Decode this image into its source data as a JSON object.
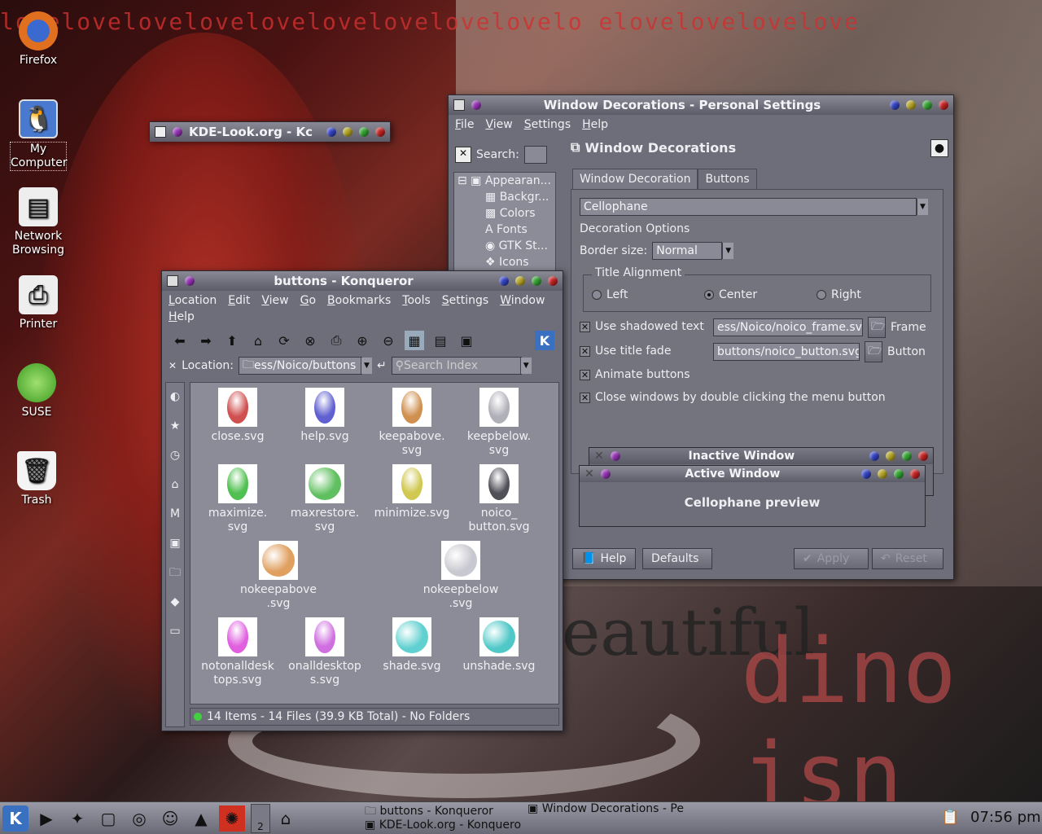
{
  "desktop": {
    "wallpaper_text": "lovelovelovelovelovelovelovelovelovelo elovelovelovelove",
    "wallpaper_big1": "eautiful",
    "wallpaper_big2": "dino jsn",
    "icons": [
      {
        "label": "Firefox"
      },
      {
        "label": "My Computer"
      },
      {
        "label": "Network Browsing"
      },
      {
        "label": "Printer"
      },
      {
        "label": "SUSE"
      },
      {
        "label": "Trash"
      }
    ]
  },
  "kdelook_window": {
    "title": "KDE-Look.org - Kc"
  },
  "konqueror": {
    "title": "buttons - Konqueror",
    "menu": [
      "Location",
      "Edit",
      "View",
      "Go",
      "Bookmarks",
      "Tools",
      "Settings",
      "Window",
      "Help"
    ],
    "location_label": "Location:",
    "location_value": "ess/Noico/buttons",
    "search_placeholder": "Search Index",
    "files": [
      {
        "name": "close.svg",
        "color": "#d05050"
      },
      {
        "name": "help.svg",
        "color": "#6060d0"
      },
      {
        "name": "keepabove.\nsvg",
        "color": "#d09050"
      },
      {
        "name": "keepbelow.\nsvg",
        "color": "#b0b0b8"
      },
      {
        "name": "maximize.\nsvg",
        "color": "#50c050"
      },
      {
        "name": "maxrestore.\nsvg",
        "color": "#60c060"
      },
      {
        "name": "minimize.svg",
        "color": "#d0c850"
      },
      {
        "name": "noico_\nbutton.svg",
        "color": "#505058"
      },
      {
        "name": "nokeepabove\n.svg",
        "color": "#e0a060"
      },
      {
        "name": "nokeepbelow\n.svg",
        "color": "#c8c8d0"
      },
      {
        "name": "notonalldesk\ntops.svg",
        "color": "#e060e0"
      },
      {
        "name": "onalldesktop\ns.svg",
        "color": "#d070e0"
      },
      {
        "name": "shade.svg",
        "color": "#60d0d0"
      },
      {
        "name": "unshade.svg",
        "color": "#50c8c8"
      }
    ],
    "status": "14 Items - 14 Files (39.9 KB Total) - No Folders"
  },
  "wdec": {
    "title": "Window Decorations - Personal Settings",
    "menu": [
      "File",
      "View",
      "Settings",
      "Help"
    ],
    "search_label": "Search:",
    "nav": [
      "Appearan...",
      "Backgr...",
      "Colors",
      "Fonts",
      "GTK St...",
      "Icons"
    ],
    "heading": "Window Decorations",
    "tabs": [
      "Window Decoration",
      "Buttons"
    ],
    "decoration": "Cellophane",
    "options_label": "Decoration Options",
    "border_label": "Border size:",
    "border_value": "Normal",
    "title_alignment_label": "Title Alignment",
    "align_left": "Left",
    "align_center": "Center",
    "align_right": "Right",
    "shadowed_label": "Use shadowed text",
    "frame_path": "ess/Noico/noico_frame.svg",
    "frame_label": "Frame",
    "fade_label": "Use title fade",
    "button_path": "buttons/noico_button.svg",
    "button_label": "Button",
    "animate_label": "Animate buttons",
    "close_dbl_label": "Close windows by double clicking the menu button",
    "inactive_title": "Inactive Window",
    "active_title": "Active Window",
    "preview_text": "Cellophane preview",
    "help_btn": "Help",
    "defaults_btn": "Defaults",
    "apply_btn": "Apply",
    "reset_btn": "Reset"
  },
  "taskbar": {
    "desktop_num": "2",
    "task1": "buttons - Konqueror",
    "task2": "Window Decorations - Pe",
    "task3": "KDE-Look.org - Konquero",
    "clock": "07:56 pm"
  }
}
